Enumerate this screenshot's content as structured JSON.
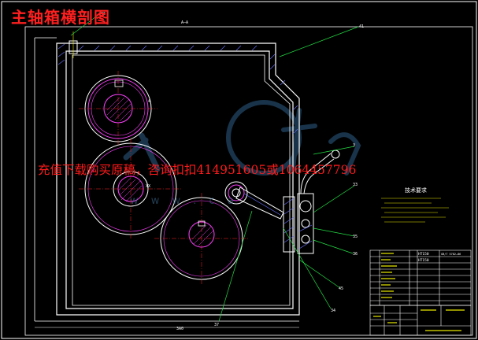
{
  "title": "主轴箱横剖图",
  "promo_text": "充值下载购买原稿，咨询扣扣414951605或1064457796",
  "watermark_url": "w w w . c a",
  "view_label": "A—A",
  "part_labels": {
    "p42": "42",
    "p41": "41",
    "p4": "4",
    "p3": "3",
    "pXX": "XX",
    "p33": "33",
    "p45": "45",
    "p34": "34",
    "p35": "35",
    "p36": "36",
    "p37": "37"
  },
  "tech_req_title": "技术要求",
  "tech_req_lines": [
    "",
    "",
    "",
    "",
    "",
    ""
  ],
  "bom_materials": {
    "row1": "HT150",
    "row2": "HT150",
    "std": "GB/T 5782—86"
  },
  "bottom_dim": "3A0",
  "colors": {
    "outline": "#ffffff",
    "gear": "#ff40ff",
    "leader": "#22dd44",
    "hatch": "#6a72ff",
    "red": "#ff2020",
    "yellow": "#e8e800",
    "watermark": "#2f5f88"
  }
}
